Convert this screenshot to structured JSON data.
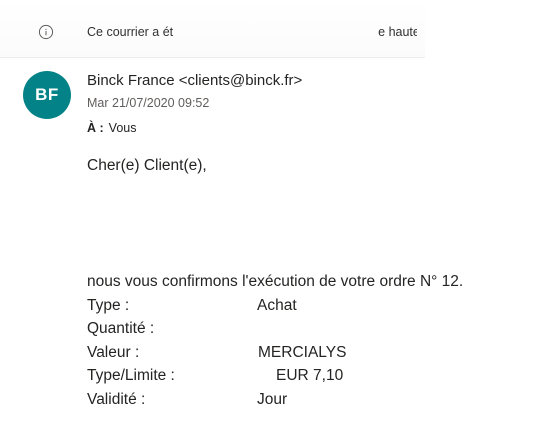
{
  "banner": {
    "text_start": "Ce courrier a ét",
    "text_end": "e haute"
  },
  "message": {
    "avatar_initials": "BF",
    "avatar_color": "#038387",
    "sender": "Binck France <clients@binck.fr>",
    "date": "Mar 21/07/2020 09:52",
    "to_label": "À :",
    "to_value": "Vous"
  },
  "body": {
    "greeting": "Cher(e) Client(e),",
    "confirmation": "nous vous confirmons l'exécution de votre ordre N° 12.",
    "rows": [
      {
        "label": "Type :",
        "value": "Achat"
      },
      {
        "label": "Quantité :",
        "value": ""
      },
      {
        "label": "Valeur :",
        "value": "MERCIALYS"
      },
      {
        "label": "Type/Limite :",
        "value": "EUR 7,10"
      },
      {
        "label": "Validité :",
        "value": "Jour"
      }
    ]
  }
}
